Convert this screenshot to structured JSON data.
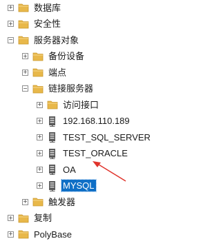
{
  "tree": {
    "items": [
      {
        "label": "数据库",
        "level": 0,
        "expanded": false,
        "icon": "folder-icon"
      },
      {
        "label": "安全性",
        "level": 0,
        "expanded": false,
        "icon": "folder-icon"
      },
      {
        "label": "服务器对象",
        "level": 0,
        "expanded": true,
        "icon": "folder-icon"
      },
      {
        "label": "备份设备",
        "level": 1,
        "expanded": false,
        "icon": "folder-icon"
      },
      {
        "label": "端点",
        "level": 1,
        "expanded": false,
        "icon": "folder-icon"
      },
      {
        "label": "链接服务器",
        "level": 1,
        "expanded": true,
        "icon": "folder-icon"
      },
      {
        "label": "访问接口",
        "level": 2,
        "expanded": false,
        "icon": "folder-icon"
      },
      {
        "label": "192.168.110.189",
        "level": 2,
        "expanded": false,
        "icon": "linked-server-icon"
      },
      {
        "label": "TEST_SQL_SERVER",
        "level": 2,
        "expanded": false,
        "icon": "linked-server-icon"
      },
      {
        "label": "TEST_ORACLE",
        "level": 2,
        "expanded": false,
        "icon": "linked-server-icon"
      },
      {
        "label": "OA",
        "level": 2,
        "expanded": false,
        "icon": "linked-server-icon"
      },
      {
        "label": "MYSQL",
        "level": 2,
        "expanded": false,
        "icon": "linked-server-icon",
        "selected": true
      },
      {
        "label": "触发器",
        "level": 1,
        "expanded": false,
        "icon": "folder-icon"
      },
      {
        "label": "复制",
        "level": 0,
        "expanded": false,
        "icon": "folder-icon"
      },
      {
        "label": "PolyBase",
        "level": 0,
        "expanded": false,
        "icon": "folder-icon"
      }
    ]
  },
  "colors": {
    "folder": "#e8b84a",
    "selection": "#0f6fc6",
    "arrow": "#e0342c"
  }
}
